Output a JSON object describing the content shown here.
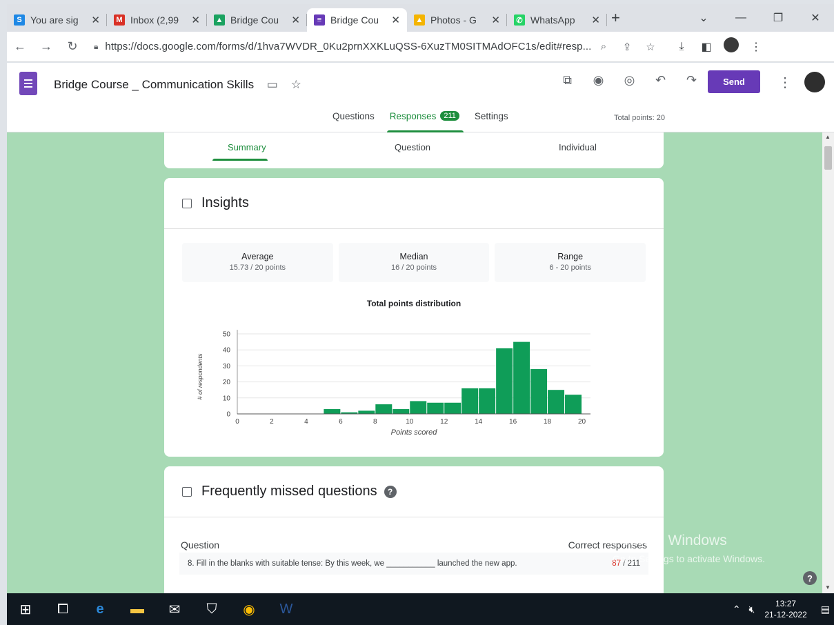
{
  "browser": {
    "tabs": [
      {
        "title": "You are sig",
        "favicon": "S",
        "color": "#1e88e5"
      },
      {
        "title": "Inbox (2,99",
        "favicon": "M",
        "color": "#d93025"
      },
      {
        "title": "Bridge Cou",
        "favicon": "▲",
        "color": "#1aa260"
      },
      {
        "title": "Bridge Cou",
        "favicon": "≡",
        "color": "#673ab7",
        "active": true
      },
      {
        "title": "Photos - G",
        "favicon": "▲",
        "color": "#f4b400"
      },
      {
        "title": "WhatsApp",
        "favicon": "✆",
        "color": "#25d366"
      }
    ],
    "url": "https://docs.google.com/forms/d/1hva7WVDR_0Ku2prnXXKLuQSS-6XuzTM0SITMAdOFC1s/edit#resp..."
  },
  "form": {
    "title": "Bridge Course _ Communication Skills",
    "send_label": "Send",
    "tabs": {
      "questions": "Questions",
      "responses": "Responses",
      "responses_count": "211",
      "settings": "Settings"
    },
    "total_points": "Total points: 20"
  },
  "subtabs": {
    "summary": "Summary",
    "question": "Question",
    "individual": "Individual"
  },
  "insights": {
    "title": "Insights",
    "stats": [
      {
        "label": "Average",
        "value": "15.73 / 20 points"
      },
      {
        "label": "Median",
        "value": "16 / 20 points"
      },
      {
        "label": "Range",
        "value": "6 - 20 points"
      }
    ]
  },
  "chart_data": {
    "type": "bar",
    "title": "Total points distribution",
    "xlabel": "Points scored",
    "ylabel": "# of respondents",
    "x": [
      5.5,
      6.5,
      7.5,
      8.5,
      9.5,
      10.5,
      11.5,
      12.5,
      13.5,
      14.5,
      15.5,
      16.5,
      17.5,
      18.5,
      19.5
    ],
    "values": [
      3,
      1,
      2,
      6,
      3,
      8,
      7,
      7,
      16,
      16,
      41,
      45,
      28,
      15,
      12
    ],
    "xlim": [
      0,
      20.5
    ],
    "ylim": [
      0,
      50
    ],
    "xticks": [
      0,
      2,
      4,
      6,
      8,
      10,
      12,
      14,
      16,
      18,
      20
    ],
    "yticks": [
      0,
      10,
      20,
      30,
      40,
      50
    ],
    "bar_color": "#0f9d58",
    "grid": true
  },
  "missed": {
    "title": "Frequently missed questions",
    "col_question": "Question",
    "col_correct": "Correct responses",
    "rows": [
      {
        "text": "8.  Fill in the blanks with suitable tense: By this week, we ___________ launched the new app.",
        "correct": "87",
        "total": "/ 211"
      }
    ]
  },
  "watermark": {
    "line1": "Activate Windows",
    "line2": "Go to Settings to activate Windows."
  },
  "taskbar": {
    "time": "13:27",
    "date": "21-12-2022"
  },
  "colors": {
    "accent": "#1e8e3e",
    "send": "#673ab7",
    "background": "#a8dab5"
  }
}
